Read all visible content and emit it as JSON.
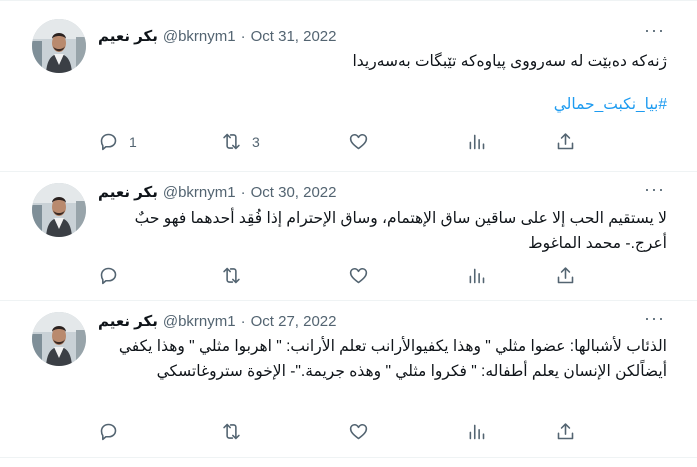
{
  "tweets": [
    {
      "name": "بكر نعيم",
      "handle": "@bkrnym1",
      "separator": "·",
      "date": "Oct 31, 2022",
      "more_icon": "···",
      "text": "ژنەکە دەبێت لە سەرووی پیاوەکە تێبگات بەسەریدا",
      "hashtag": "#بيا_نكبت_حمالي",
      "reply_count": "1",
      "retweet_count": "3",
      "like_count": "",
      "icons": [
        "reply-icon",
        "retweet-icon",
        "like-icon",
        "views-icon",
        "share-icon"
      ]
    },
    {
      "name": "بكر نعيم",
      "handle": "@bkrnym1",
      "separator": "·",
      "date": "Oct 30, 2022",
      "more_icon": "···",
      "text": "لا يستقيم الحب إلا على ساقين ساق الإهتمام، وساق الإحترام إذا فُقِد أحدهما فهو حبٌ أعرج.- محمد الماغوط",
      "reply_count": "",
      "retweet_count": "",
      "like_count": ""
    },
    {
      "name": "بكر نعيم",
      "handle": "@bkrnym1",
      "separator": "·",
      "date": "Oct 27, 2022",
      "more_icon": "···",
      "text": "الذئاب لأشبالها: عضوا مثلي \" وهذا يكفيوالأرانب تعلم الأرانب: \" اهربوا مثلي \" وهذا يكفي أيضاًلكن الإنسان يعلم أطفاله: \" فكروا مثلي \" وهذه جريمة.\"- الإخوة ستروغاتسكي",
      "reply_count": "",
      "retweet_count": "",
      "like_count": ""
    }
  ],
  "colors": {
    "text": "#0f1419",
    "secondary": "#536471",
    "link": "#1d9bf0",
    "divider": "#eff3f4"
  }
}
